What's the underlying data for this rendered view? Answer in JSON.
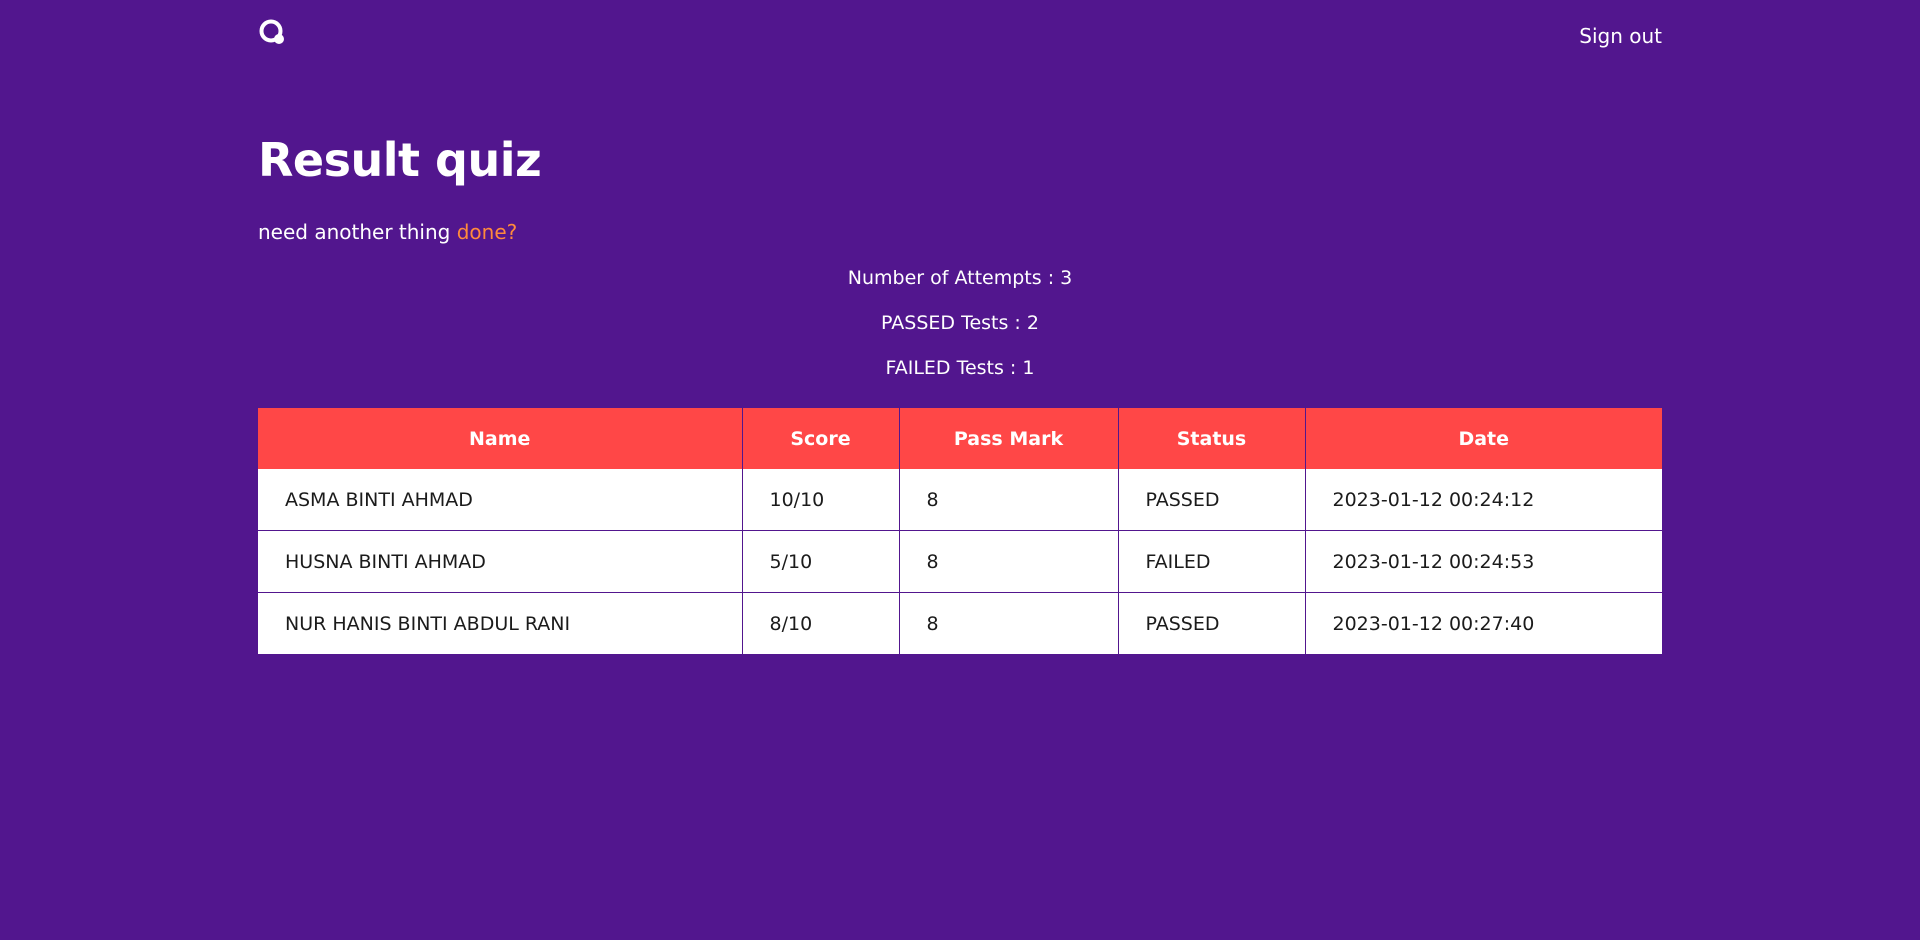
{
  "header": {
    "logo_icon": "quiz-logo-icon",
    "signout_label": "Sign out"
  },
  "page": {
    "title": "Result quiz",
    "subtitle_text": "need another thing ",
    "subtitle_link": "done?"
  },
  "stats": {
    "attempts": "Number of Attempts : 3",
    "passed": "PASSED Tests : 2",
    "failed": "FAILED Tests : 1"
  },
  "table": {
    "headers": [
      "Name",
      "Score",
      "Pass Mark",
      "Status",
      "Date"
    ],
    "rows": [
      [
        "ASMA BINTI AHMAD",
        "10/10",
        "8",
        "PASSED",
        "2023-01-12 00:24:12"
      ],
      [
        "HUSNA BINTI AHMAD",
        "5/10",
        "8",
        "FAILED",
        "2023-01-12 00:24:53"
      ],
      [
        "NUR HANIS BINTI ABDUL RANI",
        "8/10",
        "8",
        "PASSED",
        "2023-01-12 00:27:40"
      ]
    ]
  },
  "colors": {
    "background": "#52168e",
    "header_row": "#ff4747",
    "link_accent": "#ff8a3c"
  }
}
